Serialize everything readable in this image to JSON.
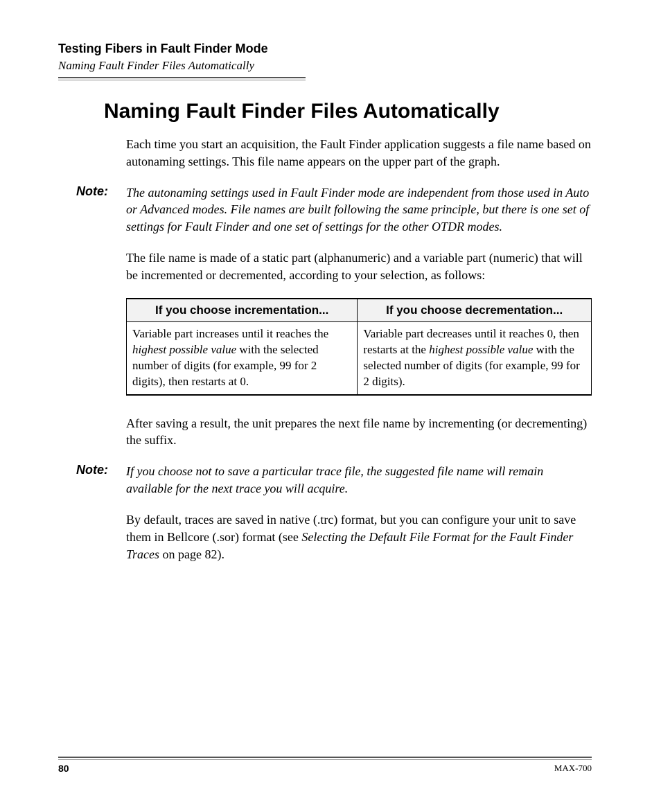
{
  "header": {
    "chapter": "Testing Fibers in Fault Finder Mode",
    "section": "Naming Fault Finder Files Automatically"
  },
  "title": "Naming Fault Finder Files Automatically",
  "intro": "Each time you start an acquisition, the Fault Finder application suggests a file name based on autonaming settings. This file name appears on the upper part of the graph.",
  "note1_label": "Note:",
  "note1_text": "The autonaming settings used in Fault Finder mode are independent from those used in Auto or Advanced modes. File names are built following the same principle, but there is one set of settings for Fault Finder and one set of settings for the other OTDR modes.",
  "filename_desc": "The file name is made of a static part (alphanumeric) and a variable part (numeric) that will be incremented or decremented, according to your selection, as follows:",
  "table": {
    "headers": [
      "If you choose incrementation...",
      "If you choose decrementation..."
    ],
    "cell_inc_pre": "Variable part increases until it reaches the ",
    "cell_inc_ital": "highest possible value",
    "cell_inc_post": " with the selected number of digits (for example, 99 for 2 digits), then restarts at 0.",
    "cell_dec_pre": "Variable part decreases until it reaches 0, then restarts at the ",
    "cell_dec_ital": "highest possible value",
    "cell_dec_post": " with the selected number of digits (for example, 99 for 2 digits)."
  },
  "after_save": "After saving a result, the unit prepares the next file name by incrementing (or decrementing) the suffix.",
  "note2_label": "Note:",
  "note2_text": "If you choose not to save a particular trace file, the suggested file name will remain available for the next trace you will acquire.",
  "default_pre": "By default, traces are saved in native (.trc) format, but you can configure your unit to save them in Bellcore (.sor) format (see ",
  "default_ital": "Selecting the Default File Format for the Fault Finder Traces",
  "default_post": " on page 82).",
  "footer": {
    "page": "80",
    "model": "MAX-700"
  }
}
